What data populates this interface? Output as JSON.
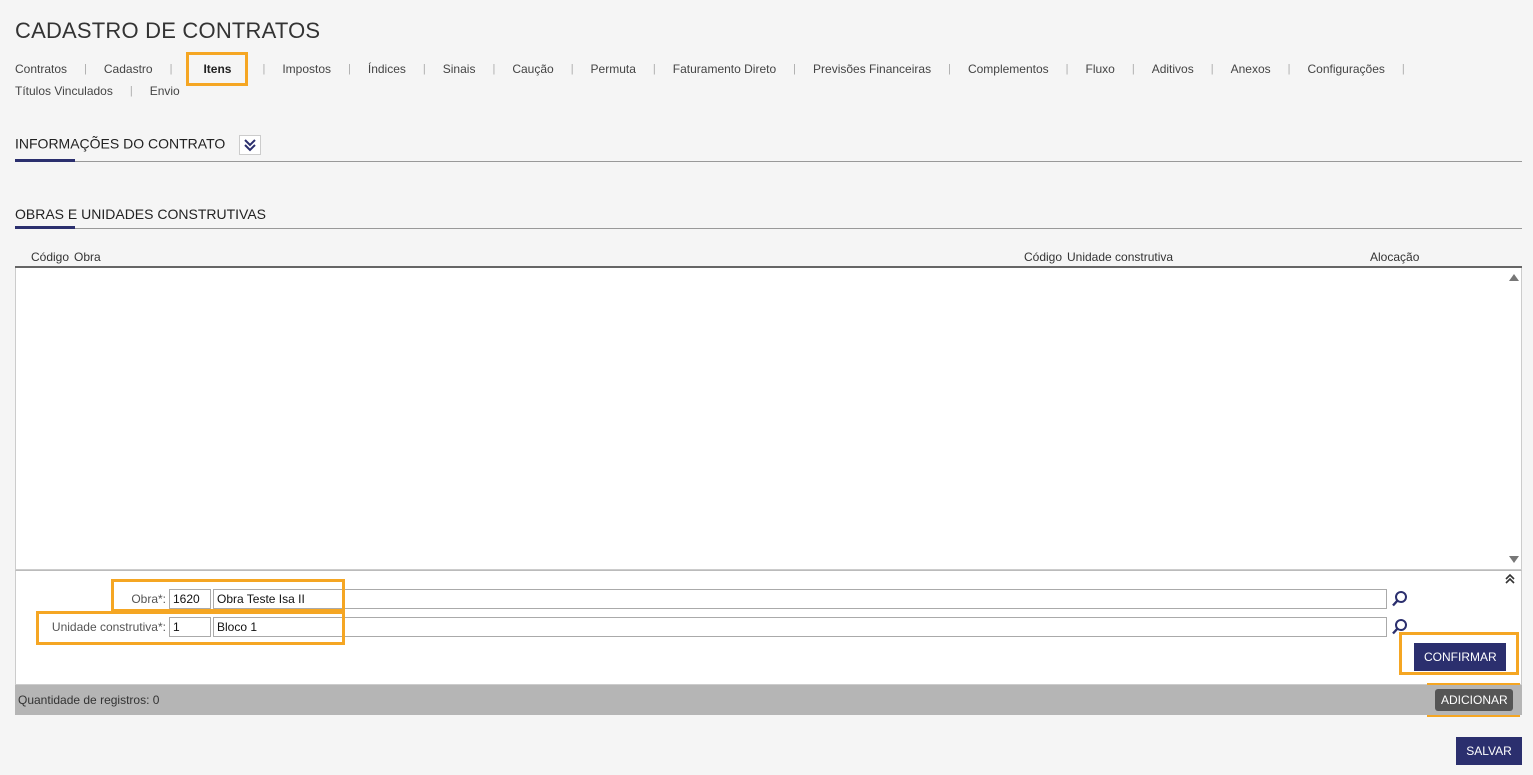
{
  "page": {
    "title": "CADASTRO DE CONTRATOS"
  },
  "tabs": [
    {
      "label": "Contratos"
    },
    {
      "label": "Cadastro"
    },
    {
      "label": "Itens",
      "active": true
    },
    {
      "label": "Impostos"
    },
    {
      "label": "Índices"
    },
    {
      "label": "Sinais"
    },
    {
      "label": "Caução"
    },
    {
      "label": "Permuta"
    },
    {
      "label": "Faturamento Direto"
    },
    {
      "label": "Previsões Financeiras"
    },
    {
      "label": "Complementos"
    },
    {
      "label": "Fluxo"
    },
    {
      "label": "Aditivos"
    },
    {
      "label": "Anexos"
    },
    {
      "label": "Configurações"
    },
    {
      "label": "Títulos Vinculados"
    },
    {
      "label": "Envio"
    }
  ],
  "sections": {
    "info": {
      "title": "INFORMAÇÕES DO CONTRATO"
    },
    "obras": {
      "title": "OBRAS E UNIDADES CONSTRUTIVAS"
    }
  },
  "grid": {
    "columns": [
      "Código",
      "Obra",
      "Código",
      "Unidade construtiva",
      "Alocação"
    ],
    "rows": []
  },
  "form": {
    "obra": {
      "label": "Obra*:",
      "code": "1620",
      "name": "Obra Teste Isa II"
    },
    "unidade": {
      "label": "Unidade construtiva*:",
      "code": "1",
      "name": "Bloco 1"
    },
    "confirm_label": "CONFIRMAR"
  },
  "footer": {
    "count_label": "Quantidade de registros: 0",
    "add_label": "ADICIONAR"
  },
  "save_label": "SALVAR",
  "colors": {
    "primary": "#2b2f6e",
    "highlight": "#f5a623",
    "footer_bg": "#b5b5b5"
  },
  "icons": [
    "double-chevron-down-icon",
    "double-chevron-up-icon",
    "search-icon",
    "scroll-up-icon",
    "scroll-down-icon"
  ]
}
